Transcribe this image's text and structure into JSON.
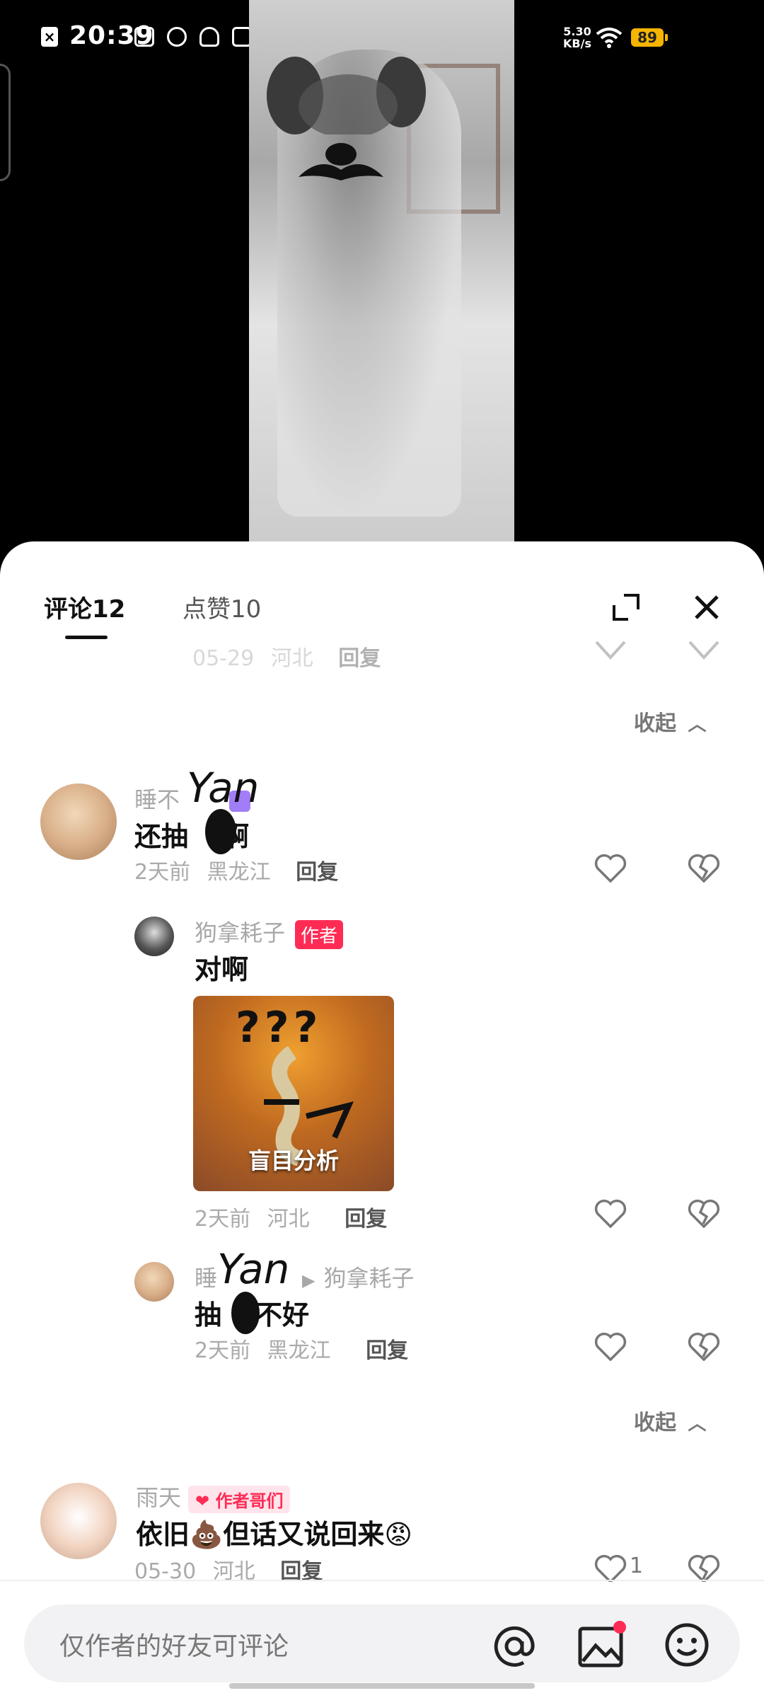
{
  "status_bar": {
    "time": "20:39",
    "net_speed_value": "5.30",
    "net_speed_unit": "KB/s",
    "battery": "89"
  },
  "tabs": {
    "comments": "评论12",
    "likes": "点赞10"
  },
  "comments": [
    {
      "meta_time": "05-29",
      "meta_region": "河北",
      "reply_label": "回复"
    },
    {
      "collapse_label": "收起"
    },
    {
      "username": "睡不",
      "text": "还抽",
      "text_tail": "啊",
      "meta_time": "2天前",
      "meta_region": "黑龙江",
      "reply_label": "回复",
      "scribble": "Yan"
    },
    {
      "username": "狗拿耗子",
      "badge": "作者",
      "text": "对啊",
      "sticker_caption": "盲目分析",
      "sticker_marks": "???",
      "meta_time": "2天前",
      "meta_region": "河北",
      "reply_label": "回复"
    },
    {
      "username": "睡",
      "reply_to": "狗拿耗子",
      "text": "抽",
      "text_tail": "不好",
      "meta_time": "2天前",
      "meta_region": "黑龙江",
      "reply_label": "回复",
      "scribble": "Yan"
    },
    {
      "collapse_label": "收起"
    },
    {
      "username": "雨天",
      "badge": "作者哥们",
      "text": "依旧💩但话又说回来😡",
      "meta_time": "05-30",
      "meta_region": "河北",
      "reply_label": "回复",
      "like_count": "1"
    }
  ],
  "input": {
    "placeholder": "仅作者的好友可评论"
  },
  "colors": {
    "accent": "#fe2c55",
    "battery": "#f5b400"
  }
}
